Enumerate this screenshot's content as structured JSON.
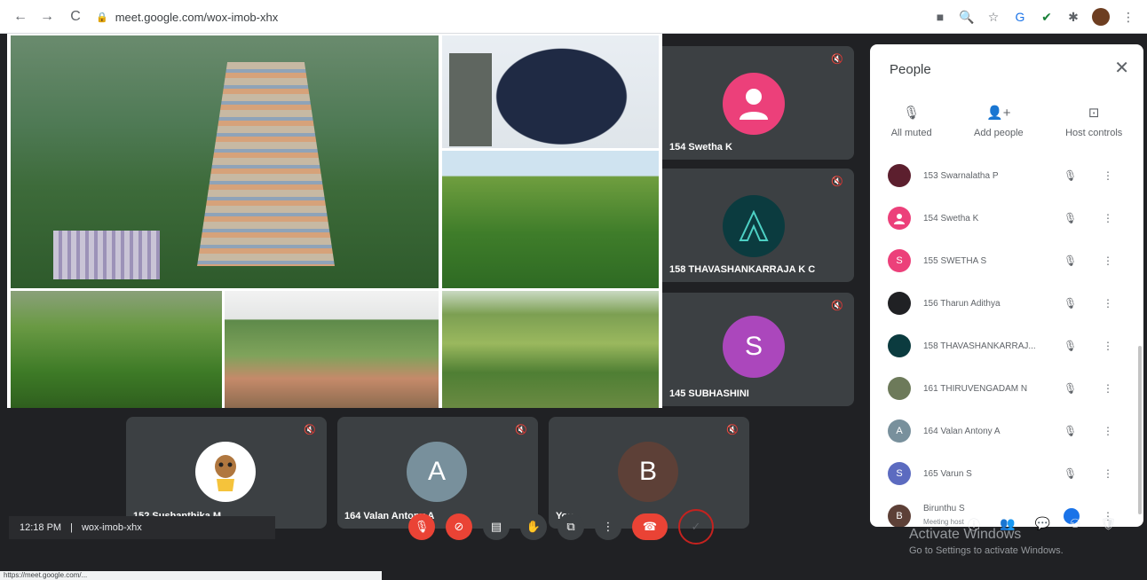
{
  "browser": {
    "url": "meet.google.com/wox-imob-xhx"
  },
  "tiles": [
    {
      "name": "154 Swetha K",
      "avatar_color": "#ec407a"
    },
    {
      "name": "158 THAVASHANKARRAJA K C",
      "avatar_color": "#0b3b3f"
    },
    {
      "name": "145 SUBHASHINI",
      "avatar_letter": "S",
      "avatar_color": "#ab47bc"
    }
  ],
  "bottom_tiles": [
    {
      "name": "152 Sushanthika M",
      "avatar_color": "#ffffff"
    },
    {
      "name": "164 Valan Antony A",
      "avatar_letter": "A",
      "avatar_color": "#78909c"
    },
    {
      "name": "You",
      "avatar_letter": "B",
      "avatar_color": "#5d4037"
    }
  ],
  "panel": {
    "title": "People",
    "actions": [
      {
        "label": "All muted",
        "icon": "mic-off-icon"
      },
      {
        "label": "Add people",
        "icon": "add-person-icon"
      },
      {
        "label": "Host controls",
        "icon": "host-controls-icon"
      }
    ],
    "participants": [
      {
        "name": "153 Swarnalatha P",
        "avatar_color": "#5c1f2e"
      },
      {
        "name": "154 Swetha K",
        "avatar_color": "#ec407a"
      },
      {
        "name": "155 SWETHA S",
        "letter": "S",
        "avatar_color": "#ec407a"
      },
      {
        "name": "156 Tharun Adithya",
        "avatar_color": "#202124"
      },
      {
        "name": "158 THAVASHANKARRAJ...",
        "avatar_color": "#0b3b3f"
      },
      {
        "name": "161 THIRUVENGADAM N",
        "avatar_color": "#6d7a5a"
      },
      {
        "name": "164 Valan Antony A",
        "letter": "A",
        "avatar_color": "#78909c"
      },
      {
        "name": "165 Varun S",
        "letter": "S",
        "avatar_color": "#5c6bc0"
      },
      {
        "name": "Birunthu S",
        "sub": "Meeting host",
        "letter": "B",
        "avatar_color": "#5d4037"
      }
    ]
  },
  "bottom_bar": {
    "time": "12:18 PM",
    "separator": "|",
    "meeting_code": "wox-imob-xhx"
  },
  "watermark": {
    "line1": "Activate Windows",
    "line2": "Go to Settings to activate Windows."
  },
  "status_url": "https://meet.google.com/..."
}
